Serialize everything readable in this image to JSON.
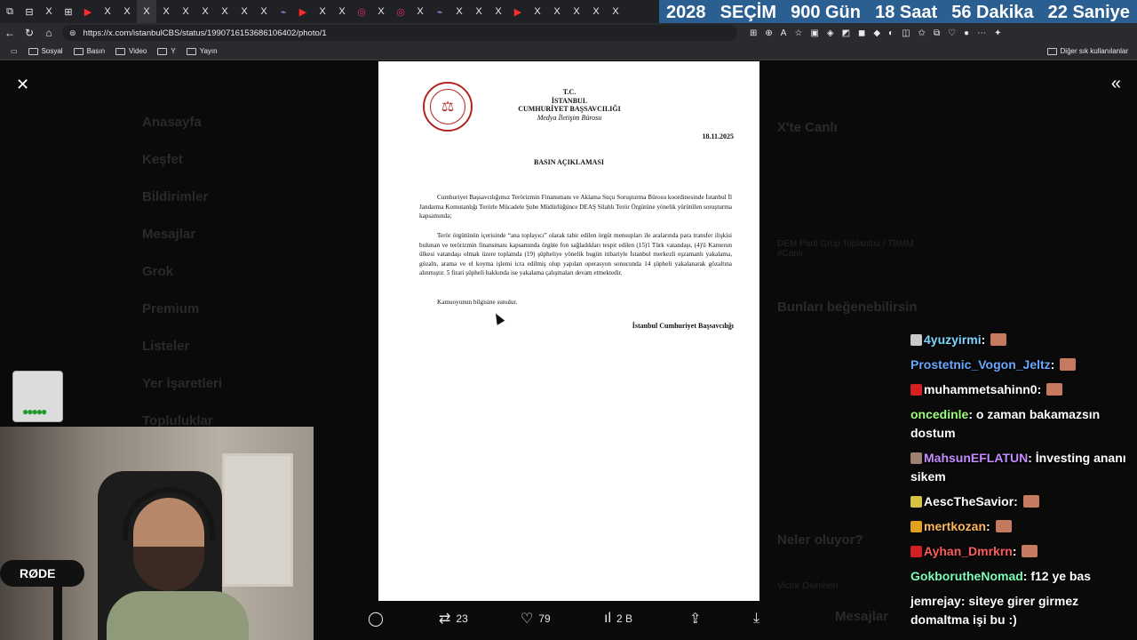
{
  "browser": {
    "tabs": [
      "⧉",
      "⊟",
      "X",
      "⊞",
      "▶",
      "X",
      "X",
      "X",
      "X",
      "X",
      "X",
      "X",
      "X",
      "X",
      "⌁",
      "▶",
      "X",
      "X",
      "◎",
      "X",
      "◎",
      "X",
      "⌁",
      "X",
      "X",
      "X",
      "▶",
      "X",
      "X",
      "X",
      "X",
      "X"
    ],
    "url": "https://x.com/istanbulCBS/status/1990716153686106402/photo/1",
    "bookmarks": [
      "Sosyal",
      "Basın",
      "Video",
      "Y",
      "Yayın"
    ],
    "other_bookmarks": "Diğer sık kullanılanlar"
  },
  "countdown": {
    "year": "2028",
    "label": "SEÇİM",
    "days": "900 Gün",
    "hours": "18 Saat",
    "minutes": "56 Dakika",
    "seconds": "22 Saniye"
  },
  "background_ui": {
    "nav": [
      "Anasayfa",
      "Keşfet",
      "Bildirimler",
      "Mesajlar",
      "Grok",
      "Premium",
      "Listeler",
      "Yer İşaretleri",
      "Topluluklar"
    ],
    "right_title": "X'te Canlı",
    "right_items": [
      "DEM Parti Grup Toplantısı / TBMM #Canlı"
    ],
    "suggest_title": "Bunları beğenebilirsin",
    "whats_happening": "Neler oluyor?",
    "person": "Victor Osimhen",
    "messages": "Mesajlar"
  },
  "document": {
    "header_tc": "T.C.",
    "header_city": "İSTANBUL",
    "header_office": "CUMHURİYET BAŞSAVCILIĞI",
    "header_unit": "Medya İletişim Bürosu",
    "date": "18.11.2025",
    "title": "BASIN AÇIKLAMASI",
    "para1": "Cumhuriyet Başsavcılığımız Terörizmin Finansmanı ve Aklama Suçu Soruşturma Bürosu koordinesinde İstanbul İl Jandarma Komutanlığı Terörle Mücadele Şube Müdürlüğünce DEAŞ Silahlı Terör Örgütüne yönelik yürütülen soruşturma kapsamında;",
    "para2": "Terör örgütünün içerisinde “ana toplayıcı” olarak tabir edilen örgüt mensupları ile aralarında para transfer ilişkisi bulunan ve terörizmin finansmanı kapsamında örgüte fon sağladıkları tespit edilen (15)'i Türk vatandaşı, (4)'ü Kamerun ülkesi vatandaşı olmak üzere toplamda (19) şüpheliye yönelik bugün itibariyle İstanbul merkezli eşzamanlı yakalama, gözaltı, arama ve el koyma işlemi icra edilmiş olup yapılan operasyon sonucunda 14 şüpheli yakalanarak gözaltına alınmıştır. 5 firari şüpheli hakkında ise yakalama çalışmaları devam etmektedir.",
    "para3": "Kamuoyunun bilgisine sunulur.",
    "signature": "İstanbul Cumhuriyet Başsavcılığı"
  },
  "actions": {
    "retweets": "23",
    "likes": "79",
    "views": "2 B"
  },
  "webcam": {
    "mic_brand": "RØDE"
  },
  "chat": [
    {
      "user": "4yuzyirmi",
      "color": "#7fd6ff",
      "message": "",
      "badge_color": "#c9c9c9",
      "emote": true
    },
    {
      "user": "Prostetnic_Vogon_Jeltz",
      "color": "#6aa7ff",
      "message": "",
      "badge_color": "",
      "emote": true
    },
    {
      "user": "muhammetsahinn0",
      "color": "#ffffff",
      "message": "",
      "badge_color": "#d32020",
      "emote": true
    },
    {
      "user": "oncedinle",
      "color": "#9cff7a",
      "message": "o zaman bakamazsın dostum",
      "badge_color": "",
      "emote": false
    },
    {
      "user": "MahsunEFLATUN",
      "color": "#c38cff",
      "message": "İnvesting ananı sikem",
      "badge_color": "#a08070",
      "emote": false
    },
    {
      "user": "AescTheSavior",
      "color": "#ffffff",
      "message": "",
      "badge_color": "#d8c040",
      "emote": true
    },
    {
      "user": "mertkozan",
      "color": "#ffb85c",
      "message": "",
      "badge_color": "#e0a020",
      "emote": true
    },
    {
      "user": "Ayhan_Dmrkrn",
      "color": "#ff5c5c",
      "message": "",
      "badge_color": "#d32020",
      "emote": true
    },
    {
      "user": "GokborutheNomad",
      "color": "#7dffb5",
      "message": "f12 ye bas",
      "badge_color": "",
      "emote": false
    },
    {
      "user": "jemrejay",
      "color": "#ffffff",
      "message": "siteye girer girmez domaltma işi bu :)",
      "badge_color": "",
      "emote": false
    }
  ]
}
